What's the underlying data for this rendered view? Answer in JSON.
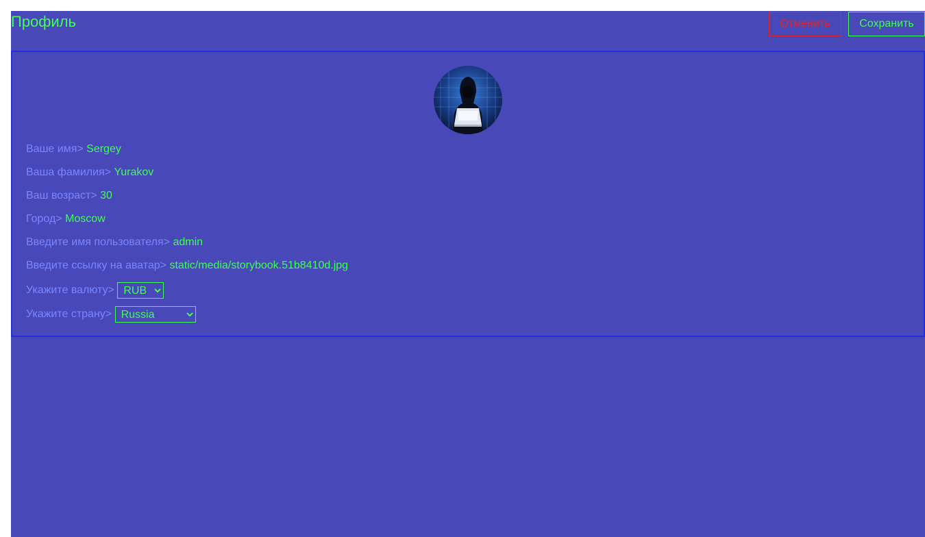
{
  "header": {
    "title": "Профиль",
    "cancel_label": "Отменить",
    "save_label": "Сохранить"
  },
  "avatar": {
    "alt": "avatar"
  },
  "fields": {
    "first_name": {
      "label": "Ваше имя>",
      "value": "Sergey"
    },
    "last_name": {
      "label": "Ваша фамилия>",
      "value": "Yurakov"
    },
    "age": {
      "label": "Ваш возраст>",
      "value": "30"
    },
    "city": {
      "label": "Город>",
      "value": "Moscow"
    },
    "username": {
      "label": "Введите имя пользователя>",
      "value": "admin"
    },
    "avatar_url": {
      "label": "Введите ссылку на аватар>",
      "value": "static/media/storybook.51b8410d.jpg"
    },
    "currency": {
      "label": "Укажите валюту>",
      "value": "RUB"
    },
    "country": {
      "label": "Укажите страну>",
      "value": "Russia"
    }
  },
  "colors": {
    "background": "#4848b9",
    "accent_green": "#3fff52",
    "cancel_red": "#e52525",
    "label_blue": "#7b86ff",
    "card_border": "#1f2fe2"
  }
}
